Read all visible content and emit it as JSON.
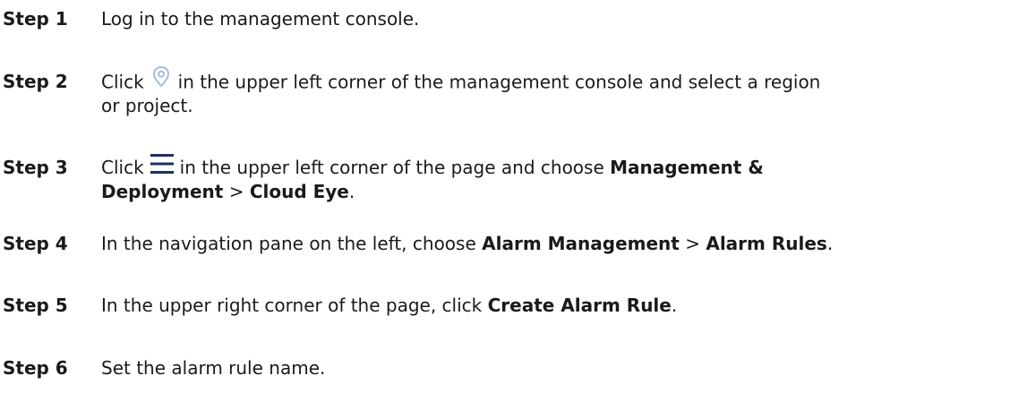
{
  "steps": [
    {
      "label": "Step 1",
      "text": "Log in to the management console."
    },
    {
      "label": "Step 2",
      "prefix": "Click",
      "icon": "location-pin-icon",
      "suffix": "in the upper left corner of the management console and select a region",
      "continuation": "or project."
    },
    {
      "label": "Step 3",
      "prefix": "Click",
      "icon": "hamburger-menu-icon",
      "suffix": "in the upper left corner of the page and choose",
      "bold1": "Management &",
      "bold2": "Deployment",
      "sep": ">",
      "bold3": "Cloud Eye",
      "end": "."
    },
    {
      "label": "Step 4",
      "prefix": "In the navigation pane on the left, choose",
      "bold1": "Alarm Management",
      "sep": ">",
      "bold2": "Alarm Rules",
      "end": "."
    },
    {
      "label": "Step 5",
      "prefix": "In the upper right corner of the page, click",
      "bold1": "Create Alarm Rule",
      "end": "."
    },
    {
      "label": "Step 6",
      "text": "Set the alarm rule name."
    }
  ],
  "colors": {
    "text": "#1a1a1a",
    "pin_icon": "#9fb4e6",
    "menu_icon": "#1c2f66"
  }
}
